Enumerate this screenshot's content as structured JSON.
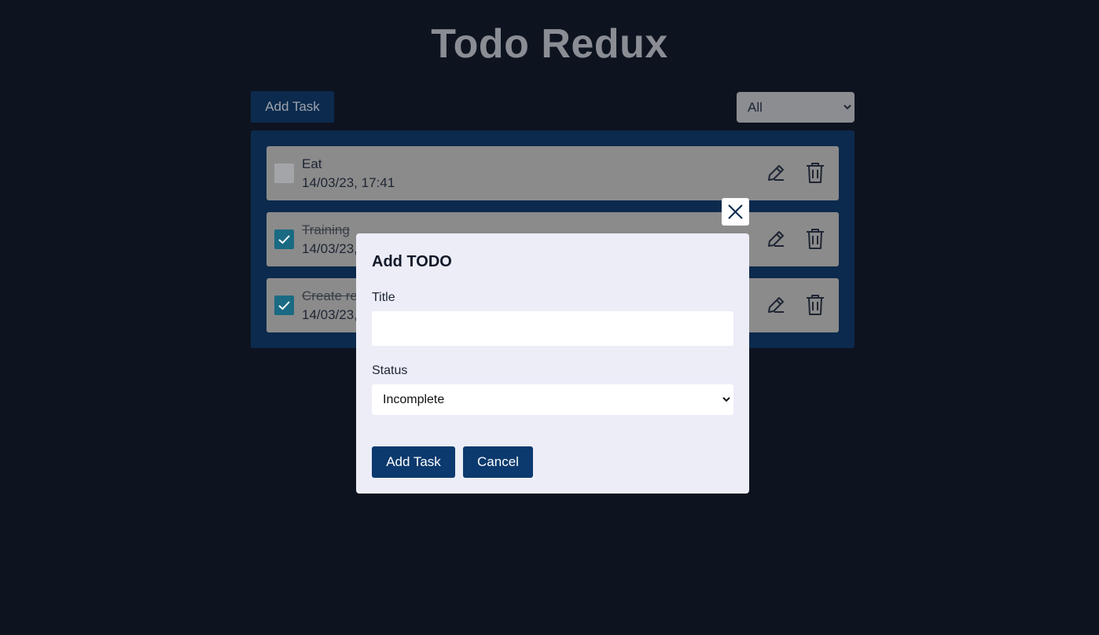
{
  "app": {
    "title": "Todo Redux"
  },
  "toolbar": {
    "add_label": "Add Task",
    "filter_value": "All"
  },
  "todos": [
    {
      "title": "Eat",
      "time": "14/03/23, 17:41",
      "completed": false
    },
    {
      "title": "Training",
      "time": "14/03/23,",
      "completed": true
    },
    {
      "title": "Create re",
      "time": "14/03/23,",
      "completed": true
    }
  ],
  "modal": {
    "heading": "Add TODO",
    "title_label": "Title",
    "title_value": "",
    "status_label": "Status",
    "status_value": "Incomplete",
    "add_label": "Add Task",
    "cancel_label": "Cancel"
  },
  "colors": {
    "background": "#0e1320",
    "panel": "#0c2a4d",
    "item": "#8b8b8b",
    "check": "#1a6a83",
    "modal_bg": "#ecedf7",
    "button": "#0c3a6e"
  },
  "icons": {
    "edit": "pencil-icon",
    "delete": "trash-icon",
    "close": "close-icon",
    "check": "check-icon",
    "chevron": "chevron-down-icon"
  }
}
